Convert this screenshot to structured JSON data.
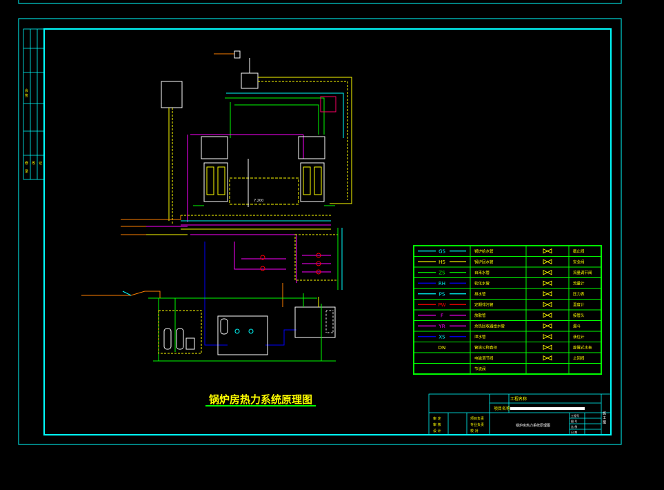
{
  "drawing": {
    "main_title": "锅炉房热力系统原理图",
    "elevation_label": "7.200",
    "colors": {
      "frame": "#00ffff",
      "title_underline": "#00ff00",
      "legend_border": "#00ff00"
    }
  },
  "legend": {
    "rows": [
      {
        "code": "GS",
        "line_color": "#00ffff",
        "text_color": "#00ffff",
        "pipe_name": "锅炉给水管",
        "symbol_icon": "gate-valve-icon",
        "symbol_name": "截止阀"
      },
      {
        "code": "HS",
        "line_color": "#ffff00",
        "text_color": "#ffff00",
        "pipe_name": "锅炉回水管",
        "symbol_icon": "safety-valve-icon",
        "symbol_name": "安全阀"
      },
      {
        "code": "ZS",
        "line_color": "#00ff00",
        "text_color": "#00ff00",
        "pipe_name": "自来水管",
        "symbol_icon": "balance-valve-icon",
        "symbol_name": "流量调节阀"
      },
      {
        "code": "RH",
        "line_color": "#0000ff",
        "text_color": "#00ffff",
        "pipe_name": "软化水管",
        "symbol_icon": "flowmeter-icon",
        "symbol_name": "流量计"
      },
      {
        "code": "PS",
        "line_color": "#00ffff",
        "text_color": "#00ffff",
        "pipe_name": "排水管",
        "symbol_icon": "pressure-gauge-icon",
        "symbol_name": "压力表"
      },
      {
        "code": "PW",
        "line_color": "#ff0000",
        "text_color": "#ff0000",
        "pipe_name": "定期排污管",
        "symbol_icon": "thermometer-icon",
        "symbol_name": "温度计"
      },
      {
        "code": "F",
        "line_color": "#ff00ff",
        "text_color": "#ff00ff",
        "pipe_name": "放散管",
        "symbol_icon": "hose-connector-icon",
        "symbol_name": "接管头"
      },
      {
        "code": "YR",
        "line_color": "#ff00ff",
        "text_color": "#ff00ff",
        "pipe_name": "余热回收器给水管",
        "symbol_icon": "funnel-icon",
        "symbol_name": "漏斗"
      },
      {
        "code": "XS",
        "line_color": "#0000ff",
        "text_color": "#00ffff",
        "pipe_name": "泄水管",
        "symbol_icon": "level-gauge-icon",
        "symbol_name": "液位计"
      },
      {
        "code": "DN",
        "line_color": "",
        "text_color": "#ffff00",
        "pipe_name": "管道公称直径",
        "symbol_icon": "spring-check-valve-icon",
        "symbol_name": "旋翼式水表"
      },
      {
        "code": "",
        "line_color": "",
        "text_color": "#ffff00",
        "pipe_name": "电磁调节阀",
        "symbol_icon": "upper-valve-icon",
        "symbol_name": "止回阀"
      },
      {
        "code": "",
        "line_color": "",
        "text_color": "#ffff00",
        "pipe_name": "节流阀",
        "symbol_icon": "",
        "symbol_name": ""
      }
    ]
  },
  "title_block": {
    "project_label": "工程名称",
    "item_label": "项目名称",
    "drawing_name": "锅炉房热力系统原理图",
    "roles_left": [
      "审 定",
      "审 核",
      "设 计"
    ],
    "roles_mid": [
      "项目负责",
      "专业负责",
      "校 对"
    ],
    "sheet_fields": [
      "工程号",
      "图 号",
      "比 例",
      "日 期"
    ],
    "right_mark": "施 工 图"
  }
}
